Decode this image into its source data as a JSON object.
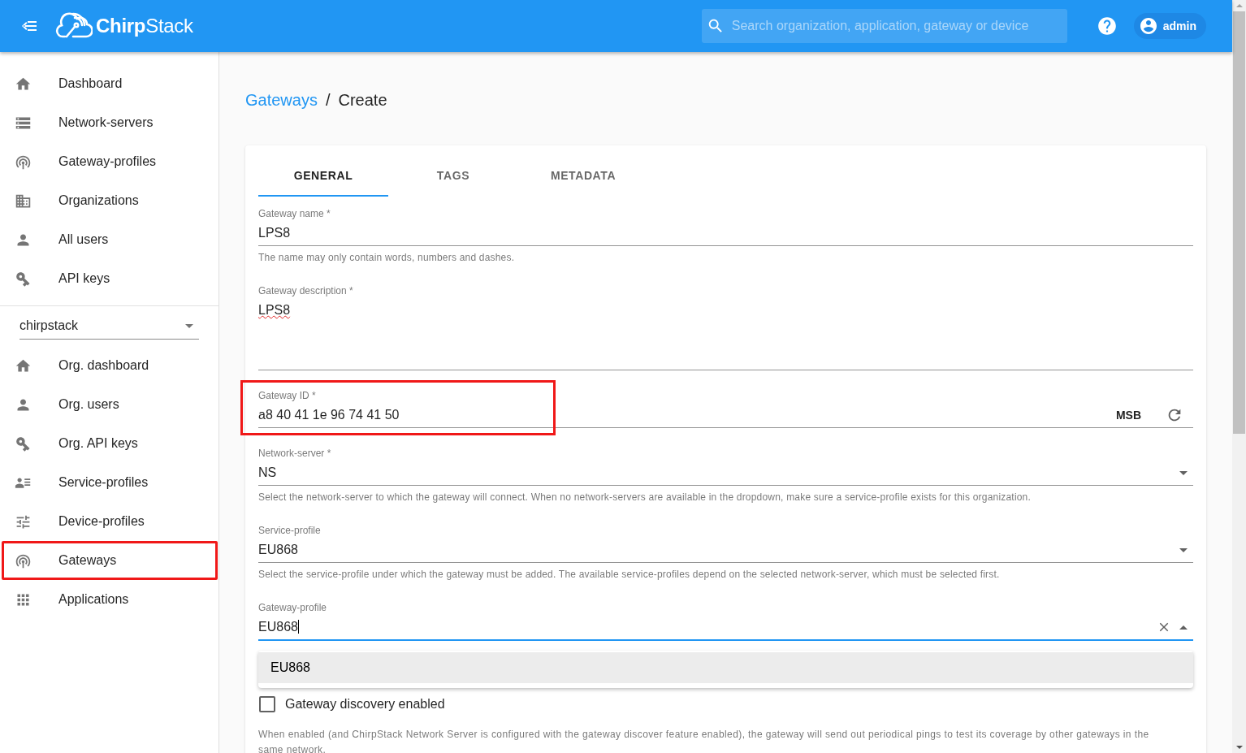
{
  "header": {
    "logo": "**Chirp**Stack",
    "search": {
      "placeholder": "Search organization, application, gateway or device"
    },
    "user": "admin"
  },
  "sidebar": {
    "items": [
      {
        "kind": "home",
        "label": "Dashboard",
        "selected": false,
        "highlighted": false
      },
      {
        "kind": "servers",
        "label": "Network-servers",
        "selected": false,
        "highlighted": false
      },
      {
        "kind": "antenna",
        "label": "Gateway-profiles",
        "selected": false,
        "highlighted": false
      },
      {
        "kind": "building",
        "label": "Organizations",
        "selected": false,
        "highlighted": false
      },
      {
        "kind": "person",
        "label": "All users",
        "selected": false,
        "highlighted": false
      },
      {
        "kind": "key",
        "label": "API keys",
        "selected": false,
        "highlighted": false
      }
    ],
    "organization": "chirpstack",
    "org_items": [
      {
        "kind": "home",
        "label": "Org. dashboard",
        "selected": false,
        "highlighted": false
      },
      {
        "kind": "person",
        "label": "Org. users",
        "selected": false,
        "highlighted": false
      },
      {
        "kind": "key",
        "label": "Org. API keys",
        "selected": false,
        "highlighted": false
      },
      {
        "kind": "profiles",
        "label": "Service-profiles",
        "selected": false,
        "highlighted": false
      },
      {
        "kind": "sliders",
        "label": "Device-profiles",
        "selected": false,
        "highlighted": false
      },
      {
        "kind": "antenna",
        "label": "Gateways",
        "selected": false,
        "highlighted": true
      },
      {
        "kind": "grid",
        "label": "Applications",
        "selected": false,
        "highlighted": false
      }
    ]
  },
  "breadcrumb": {
    "parent": "Gateways",
    "separator": "/",
    "current": "Create"
  },
  "tabs": [
    {
      "label": "GENERAL",
      "selected": true
    },
    {
      "label": "TAGS",
      "selected": false
    },
    {
      "label": "METADATA",
      "selected": false
    }
  ],
  "fields": [
    {
      "kind": "text",
      "label": "Gateway name *",
      "value": "LPS8",
      "helper": "The name may only contain words, numbers and dashes."
    },
    {
      "kind": "multiline",
      "label": "Gateway description *",
      "value": "LPS8",
      "spelling_error": true
    },
    {
      "kind": "id",
      "label": "Gateway ID *",
      "value": "a8 40 41 1e 96 74 41 50",
      "byte_order": "MSB",
      "highlighted": true
    },
    {
      "kind": "select",
      "label": "Network-server *",
      "value": "NS",
      "helper": "Select the network-server to which the gateway will connect. When no network-servers are available in the dropdown, make sure a service-profile exists for this organization."
    },
    {
      "kind": "select",
      "label": "Service-profile",
      "value": "EU868",
      "helper": "Select the service-profile under which the gateway must be added. The available service-profiles depend on the selected network-server, which must be selected first."
    },
    {
      "kind": "autocomplete",
      "label": "Gateway-profile",
      "value": "EU868",
      "focused": true,
      "options": [
        {
          "label": "EU868",
          "selected": true
        }
      ]
    }
  ],
  "checkbox": {
    "label": "Gateway discovery enabled",
    "checked": false,
    "helper": "When enabled (and ChirpStack Network Server is configured with the gateway discover feature enabled), the gateway will send out periodical pings to test its coverage by other gateways in the same network."
  }
}
